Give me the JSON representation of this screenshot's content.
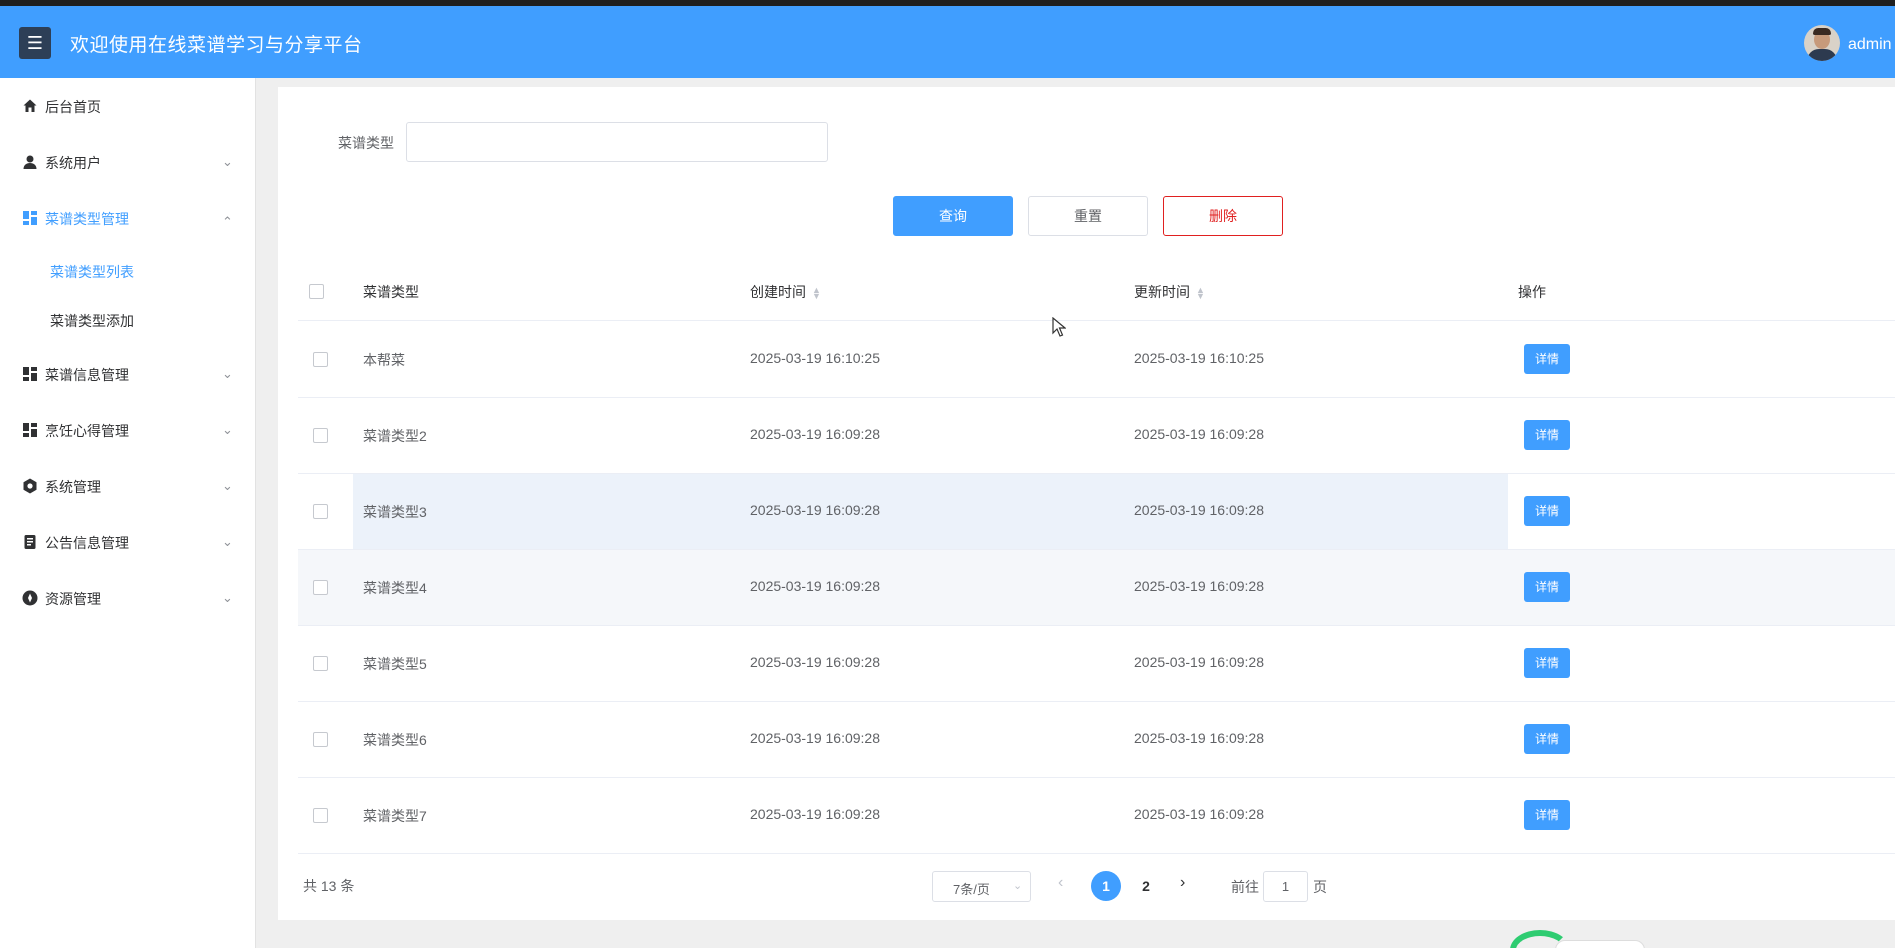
{
  "header": {
    "menu_icon": "hamburger-icon",
    "title": "欢迎使用在线菜谱学习与分享平台",
    "user_name": "admin"
  },
  "sidebar": {
    "items": [
      {
        "label": "后台首页",
        "icon": "home-icon"
      },
      {
        "label": "系统用户",
        "icon": "user-icon"
      },
      {
        "label": "菜谱类型管理",
        "icon": "grid-icon"
      },
      {
        "label": "菜谱信息管理",
        "icon": "grid-icon"
      },
      {
        "label": "烹饪心得管理",
        "icon": "grid-icon"
      },
      {
        "label": "系统管理",
        "icon": "gear-icon"
      },
      {
        "label": "公告信息管理",
        "icon": "document-icon"
      },
      {
        "label": "资源管理",
        "icon": "compass-icon"
      }
    ],
    "subitems": [
      {
        "label": "菜谱类型列表"
      },
      {
        "label": "菜谱类型添加"
      }
    ],
    "accent": "#409eff"
  },
  "filter": {
    "label": "菜谱类型",
    "value": ""
  },
  "buttons": {
    "query": "查询",
    "reset": "重置",
    "delete": "删除"
  },
  "table": {
    "headers": [
      "菜谱类型",
      "创建时间",
      "更新时间",
      "操作"
    ],
    "rows": [
      {
        "type": "本帮菜",
        "created": "2025-03-19 16:10:25",
        "updated": "2025-03-19 16:10:25",
        "action": "详情"
      },
      {
        "type": "菜谱类型2",
        "created": "2025-03-19 16:09:28",
        "updated": "2025-03-19 16:09:28",
        "action": "详情"
      },
      {
        "type": "菜谱类型3",
        "created": "2025-03-19 16:09:28",
        "updated": "2025-03-19 16:09:28",
        "action": "详情"
      },
      {
        "type": "菜谱类型4",
        "created": "2025-03-19 16:09:28",
        "updated": "2025-03-19 16:09:28",
        "action": "详情"
      },
      {
        "type": "菜谱类型5",
        "created": "2025-03-19 16:09:28",
        "updated": "2025-03-19 16:09:28",
        "action": "详情"
      },
      {
        "type": "菜谱类型6",
        "created": "2025-03-19 16:09:28",
        "updated": "2025-03-19 16:09:28",
        "action": "详情"
      },
      {
        "type": "菜谱类型7",
        "created": "2025-03-19 16:09:28",
        "updated": "2025-03-19 16:09:28",
        "action": "详情"
      }
    ]
  },
  "pagination": {
    "total": "共 13 条",
    "page_size": "7条/页",
    "pages": [
      "1",
      "2"
    ],
    "current_page": "1",
    "goto_label": "前往",
    "goto_value": "1",
    "goto_suffix": "页"
  },
  "colors": {
    "primary": "#409eff",
    "danger": "#e02020",
    "menu_toggle": "#2d3f57"
  }
}
